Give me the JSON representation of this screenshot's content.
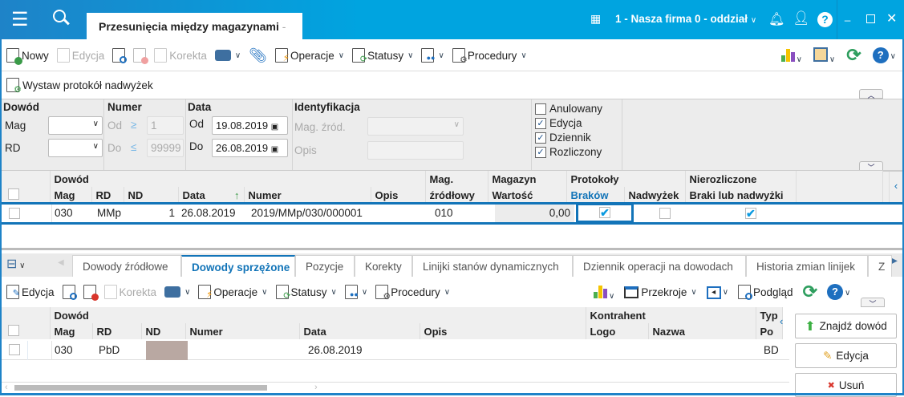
{
  "titlebar": {
    "tab_title": "Przesunięcia między magazynami",
    "tab_suffix": "-",
    "company": "1 - Nasza firma 0 - oddział"
  },
  "toolbar1": {
    "new": "Nowy",
    "edit": "Edycja",
    "correction": "Korekta",
    "operations": "Operacje",
    "statuses": "Statusy",
    "procedures": "Procedury",
    "issue_surplus": "Wystaw protokół nadwyżek"
  },
  "filters": {
    "dowod": "Dowód",
    "mag": "Mag",
    "rd": "RD",
    "numer": "Numer",
    "od": "Od",
    "do": "Do",
    "num_from": "1",
    "num_to": "99999",
    "data": "Data",
    "date_from": "19.08.2019",
    "date_to": "26.08.2019",
    "ident": "Identyfikacja",
    "mag_src": "Mag. źród.",
    "opis": "Opis",
    "checks": [
      {
        "label": "Anulowany",
        "checked": false
      },
      {
        "label": "Edycja",
        "checked": true
      },
      {
        "label": "Dziennik",
        "checked": true
      },
      {
        "label": "Rozliczony",
        "checked": true
      }
    ]
  },
  "grid1": {
    "group_dowod": "Dowód",
    "mag": "Mag",
    "rd": "RD",
    "nd": "ND",
    "data": "Data",
    "numer": "Numer",
    "opis": "Opis",
    "mag_src1": "Mag.",
    "mag_src2": "źródłowy",
    "magazyn": "Magazyn",
    "wartosc": "Wartość",
    "protokoly": "Protokoły",
    "brakow": "Braków",
    "nadwyzek": "Nadwyżek",
    "nierozliczone": "Nierozliczone",
    "braki": "Braki lub nadwyżki",
    "rows": [
      {
        "mag": "030",
        "rd": "MMp",
        "nd": "1",
        "data": "26.08.2019",
        "numer": "2019/MMp/030/000001",
        "opis": "",
        "mag_src": "010",
        "wartosc": "0,00",
        "brakow": true,
        "nadwyzek": false,
        "braki": true
      }
    ]
  },
  "tabs": [
    "Dowody źródłowe",
    "Dowody sprzężone",
    "Pozycje",
    "Korekty",
    "Linijki stanów dynamicznych",
    "Dziennik operacji na dowodach",
    "Historia zmian linijek",
    "Z"
  ],
  "toolbar2": {
    "edit": "Edycja",
    "correction": "Korekta",
    "operations": "Operacje",
    "statuses": "Statusy",
    "procedures": "Procedury",
    "sections": "Przekroje",
    "preview": "Podgląd"
  },
  "grid2": {
    "group_dowod": "Dowód",
    "mag": "Mag",
    "rd": "RD",
    "nd": "ND",
    "numer": "Numer",
    "data": "Data",
    "opis": "Opis",
    "kontrahent": "Kontrahent",
    "logo": "Logo",
    "nazwa": "Nazwa",
    "typ1": "Typ",
    "typ2": "Po",
    "rows": [
      {
        "mag": "030",
        "rd": "PbD",
        "nd": "",
        "numer": "",
        "data": "26.08.2019",
        "opis": "",
        "logo": "",
        "nazwa": "",
        "typ": "BD"
      }
    ]
  },
  "side": {
    "find": "Znajdź dowód",
    "edit": "Edycja",
    "delete": "Usuń"
  }
}
